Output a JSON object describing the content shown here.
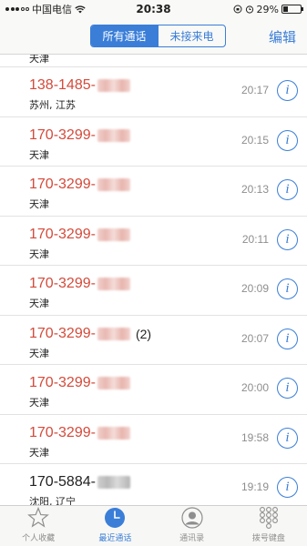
{
  "status_bar": {
    "carrier": "中国电信",
    "time": "20:38",
    "battery": "29%",
    "battery_level": 0.29
  },
  "nav": {
    "segments": [
      "所有通话",
      "未接来电"
    ],
    "active_segment": 0,
    "edit_label": "编辑"
  },
  "partial_top_location": "天津",
  "calls": [
    {
      "number": "138-1485-",
      "count": "",
      "location": "苏州, 江苏",
      "time": "20:17",
      "missed": true
    },
    {
      "number": "170-3299-",
      "count": "",
      "location": "天津",
      "time": "20:15",
      "missed": true
    },
    {
      "number": "170-3299-",
      "count": "",
      "location": "天津",
      "time": "20:13",
      "missed": true
    },
    {
      "number": "170-3299-",
      "count": "",
      "location": "天津",
      "time": "20:11",
      "missed": true
    },
    {
      "number": "170-3299-",
      "count": "",
      "location": "天津",
      "time": "20:09",
      "missed": true
    },
    {
      "number": "170-3299-",
      "count": "(2)",
      "location": "天津",
      "time": "20:07",
      "missed": true
    },
    {
      "number": "170-3299-",
      "count": "",
      "location": "天津",
      "time": "20:00",
      "missed": true
    },
    {
      "number": "170-3299-",
      "count": "",
      "location": "天津",
      "time": "19:58",
      "missed": true
    },
    {
      "number": "170-5884-",
      "count": "",
      "location": "沈阳, 辽宁",
      "time": "19:19",
      "missed": false
    }
  ],
  "info_glyph": "i",
  "tabs": [
    {
      "label": "个人收藏",
      "icon": "star-icon"
    },
    {
      "label": "最近通话",
      "icon": "clock-icon"
    },
    {
      "label": "通讯录",
      "icon": "contacts-icon"
    },
    {
      "label": "拨号键盘",
      "icon": "keypad-icon"
    }
  ],
  "active_tab": 1,
  "colors": {
    "accent": "#3a7ed8",
    "missed": "#d44a3a"
  }
}
